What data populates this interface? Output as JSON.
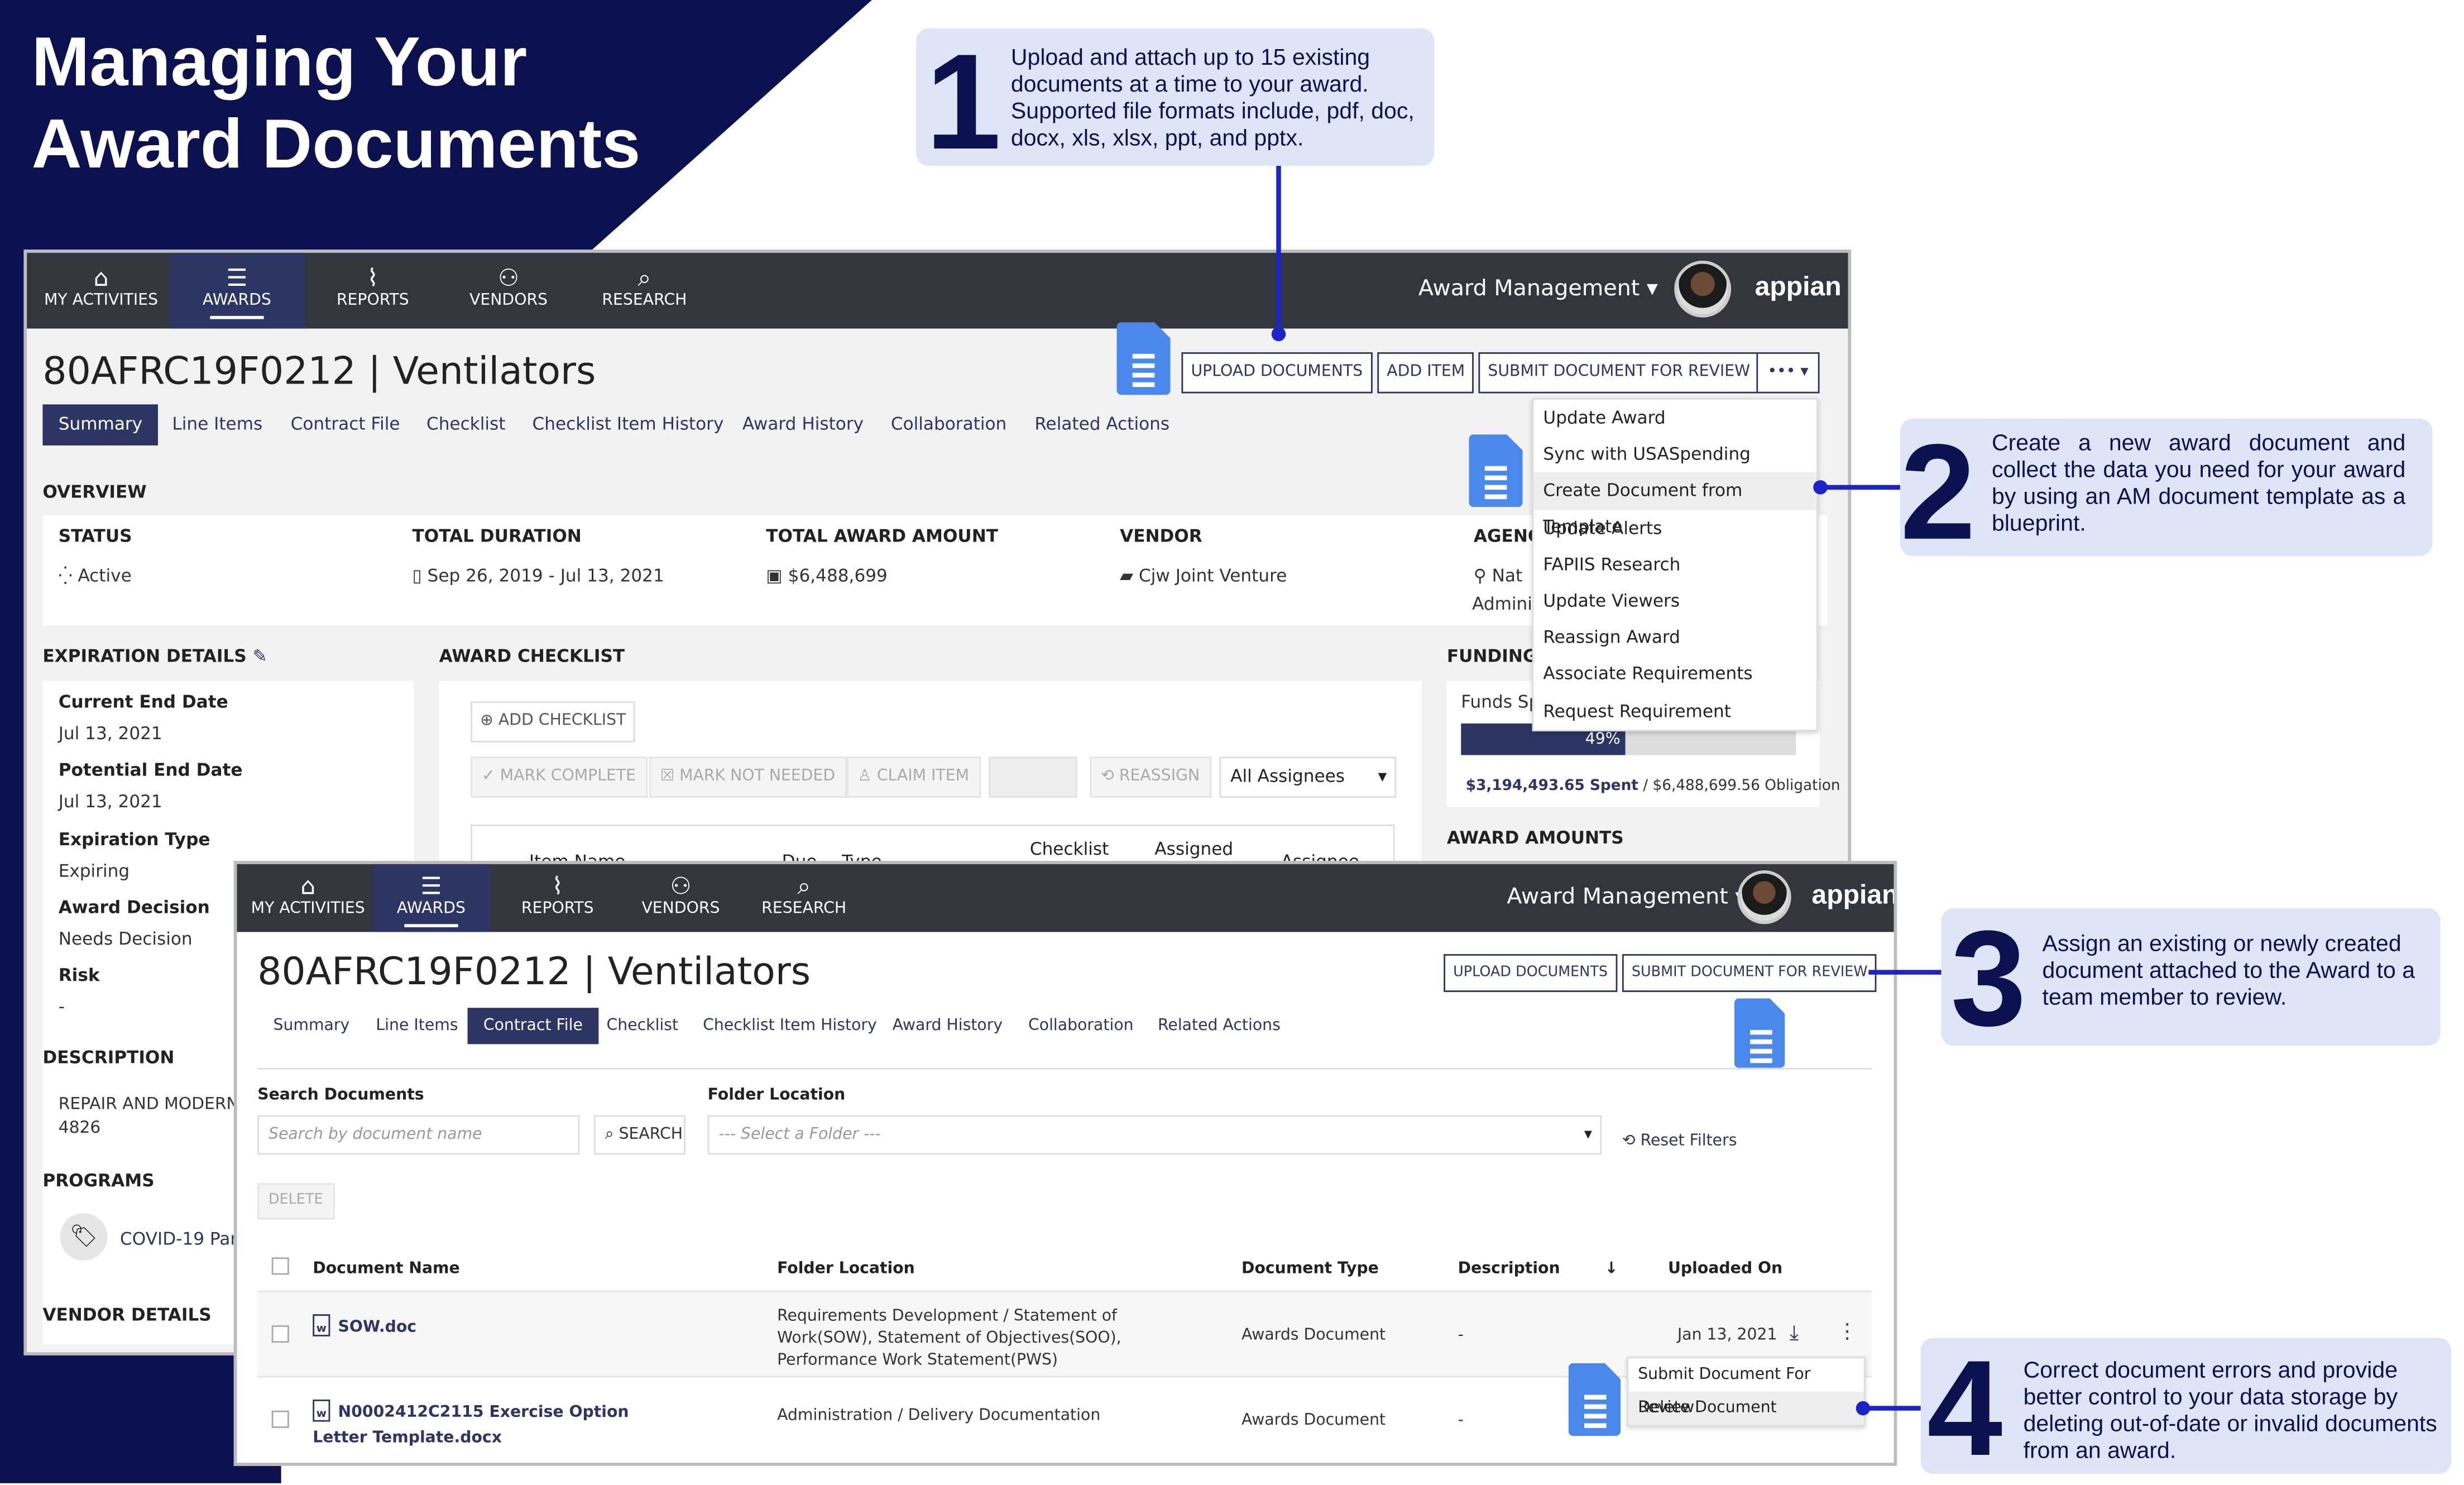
{
  "colors": {
    "navy": "#0c1250",
    "callout_bg": "#dde5f6",
    "connector": "#1a24c8",
    "nav_bg": "#33373d",
    "accent": "#2c3563",
    "doc_icon": "#4a88ec"
  },
  "title": {
    "line1": "Managing Your",
    "line2": "Award Documents"
  },
  "callouts": [
    {
      "number": "1",
      "text": "Upload and attach up to 15 existing documents at a time to your award. Supported file formats include, pdf, doc, docx, xls, xlsx, ppt, and pptx."
    },
    {
      "number": "2",
      "text": "Create a new award document and collect the data you need for your award by using an AM document template as a blueprint."
    },
    {
      "number": "3",
      "text": "Assign an existing or newly created document attached to the Award to a team member to review."
    },
    {
      "number": "4",
      "text": "Correct document errors and provide better control to your data storage by deleting out-of-date or invalid documents from an award."
    }
  ],
  "nav": {
    "items": [
      {
        "label": "MY ACTIVITIES",
        "icon": "home-icon",
        "glyph": "⌂"
      },
      {
        "label": "AWARDS",
        "icon": "list-icon",
        "glyph": "☰"
      },
      {
        "label": "REPORTS",
        "icon": "chart-icon",
        "glyph": "⌇"
      },
      {
        "label": "VENDORS",
        "icon": "users-icon",
        "glyph": "⚇"
      },
      {
        "label": "RESEARCH",
        "icon": "search-icon",
        "glyph": "⌕"
      }
    ],
    "app": "Award Management ▾",
    "logo": "appian"
  },
  "screen1": {
    "title": "80AFRC19F0212 | Ventilators",
    "buttons": {
      "upload": "UPLOAD DOCUMENTS",
      "add_item": "ADD ITEM",
      "submit": "SUBMIT DOCUMENT FOR REVIEW",
      "more": "••• ▾"
    },
    "tabs": [
      "Summary",
      "Line Items",
      "Contract File",
      "Checklist",
      "Checklist Item History",
      "Award History",
      "Collaboration",
      "Related Actions"
    ],
    "overview_label": "OVERVIEW",
    "overview": [
      {
        "label": "STATUS",
        "value": "Active",
        "icon": "⁛"
      },
      {
        "label": "TOTAL DURATION",
        "value": "Sep 26, 2019 - Jul 13, 2021",
        "icon": "▯"
      },
      {
        "label": "TOTAL AWARD AMOUNT",
        "value": "$6,488,699",
        "icon": "▣"
      },
      {
        "label": "VENDOR",
        "value": "Cjw Joint Venture",
        "icon": "▰"
      },
      {
        "label": "AGENC",
        "value": "Nat",
        "value2": "Admini",
        "icon": "⚲"
      }
    ],
    "expiration": {
      "heading": "EXPIRATION DETAILS",
      "fields": [
        {
          "label": "Current End Date",
          "value": "Jul 13, 2021"
        },
        {
          "label": "Potential End Date",
          "value": "Jul 13, 2021"
        },
        {
          "label": "Expiration Type",
          "value": "Expiring"
        },
        {
          "label": "Award Decision",
          "value": "Needs Decision"
        },
        {
          "label": "Risk",
          "value": "-"
        }
      ]
    },
    "description": {
      "heading": "DESCRIPTION",
      "value": "REPAIR AND MODERN",
      "value2": "4826"
    },
    "programs": {
      "heading": "PROGRAMS",
      "value": "COVID-19 Pan"
    },
    "vendor_details": "VENDOR DETAILS",
    "checklist": {
      "heading": "AWARD CHECKLIST",
      "add": "ADD CHECKLIST",
      "mark_complete": "MARK COMPLETE",
      "mark_not_needed": "MARK NOT NEEDED",
      "claim": "CLAIM ITEM",
      "reassign": "REASSIGN",
      "assignees": "All Assignees",
      "columns": [
        "Item Name",
        "Due",
        "Type",
        "Checklist",
        "Assigned",
        "Assignee"
      ]
    },
    "funding": {
      "heading": "FUNDING",
      "label": "Funds Sp",
      "percent": 49,
      "percent_label": "49%",
      "spent": "$3,194,493.65 Spent",
      "obligation": " / $6,488,699.56 Obligation"
    },
    "award_amounts": "AWARD AMOUNTS",
    "menu": [
      "Update Award",
      "Sync with USASpending",
      "Create Document from Template",
      "Update Alerts",
      "FAPIIS Research",
      "Update Viewers",
      "Reassign Award",
      "Associate Requirements",
      "Request Requirement"
    ]
  },
  "screen2": {
    "title": "80AFRC19F0212 | Ventilators",
    "buttons": {
      "upload": "UPLOAD DOCUMENTS",
      "submit": "SUBMIT DOCUMENT FOR REVIEW"
    },
    "tabs": [
      "Summary",
      "Line Items",
      "Contract File",
      "Checklist",
      "Checklist Item History",
      "Award History",
      "Collaboration",
      "Related Actions"
    ],
    "search_label": "Search Documents",
    "search_placeholder": "Search by document name",
    "search_btn": "SEARCH",
    "folder_label": "Folder Location",
    "folder_placeholder": "--- Select a Folder ---",
    "reset": "Reset Filters",
    "delete": "DELETE",
    "columns": [
      "Document Name",
      "Folder Location",
      "Document Type",
      "Description",
      "Uploaded On"
    ],
    "rows": [
      {
        "name": "SOW.doc",
        "folder": "Requirements Development / Statement of Work(SOW), Statement of Objectives(SOO), Performance Work Statement(PWS)",
        "type": "Awards Document",
        "description": "-",
        "uploaded": "Jan 13, 2021"
      },
      {
        "name": "N0002412C2115 Exercise Option Letter Template.docx",
        "folder": "Administration / Delivery Documentation",
        "type": "Awards Document",
        "description": "-",
        "uploaded": ""
      }
    ],
    "row_menu": [
      "Submit Document For Review",
      "Delete Document"
    ]
  }
}
